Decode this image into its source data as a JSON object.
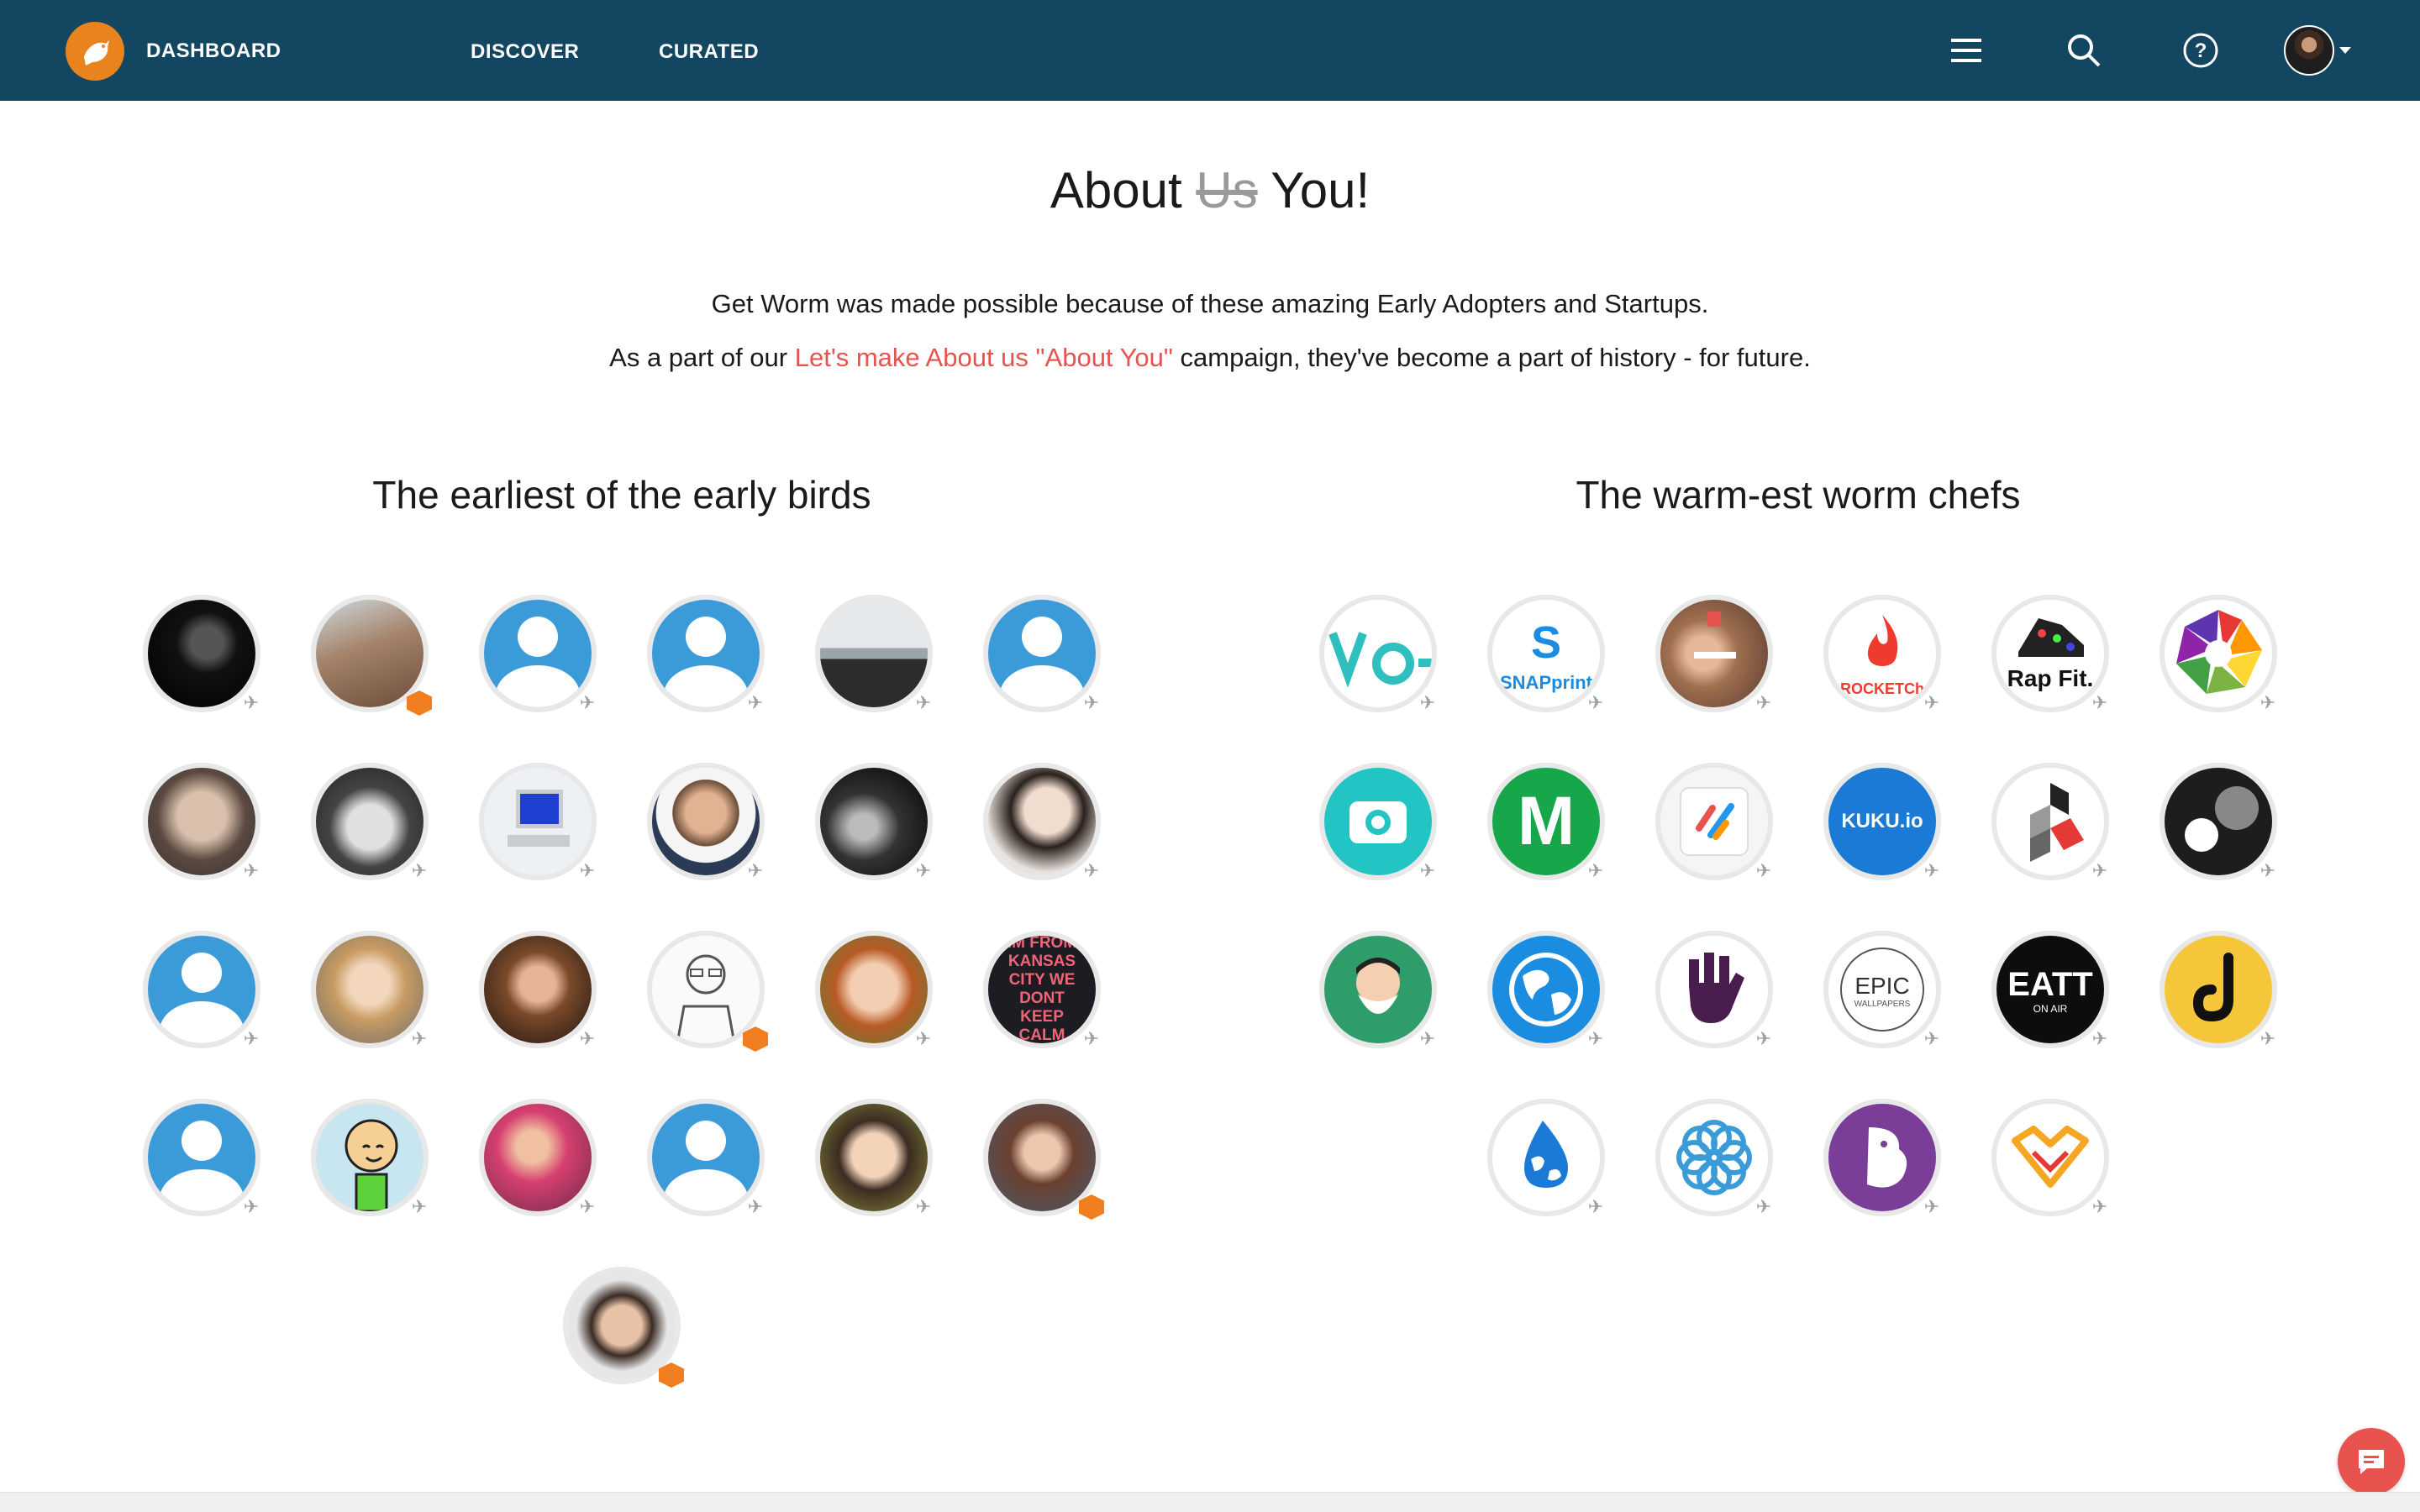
{
  "nav": {
    "brand_label": "DASHBOARD",
    "links": [
      "DISCOVER",
      "CURATED"
    ],
    "icons": [
      "menu-icon",
      "search-icon",
      "help-icon",
      "user-avatar"
    ]
  },
  "title": {
    "before": "About",
    "struck": "Us",
    "after": "You!"
  },
  "intro": {
    "line1": "Get Worm was made possible because of these amazing Early Adopters and Startups.",
    "line2_prefix": "As a part of our ",
    "line2_link": "Let's make About us \"About You\"",
    "line2_suffix": " campaign, they've become a part of history - for future."
  },
  "sections": {
    "early_birds": "The earliest of the early birds",
    "worm_chefs": "The warm-est worm chefs"
  },
  "logo_labels": {
    "snap_top": "S",
    "snap_bottom": "SNAPprint",
    "rocket": "ROCKETCh",
    "rapfit": "Rap Fit.",
    "kuku": "KUKU.io",
    "epic": "EPIC",
    "epic_sub": "WALLPAPERS",
    "eatt": "EATT",
    "eatt_sub": "ON AIR",
    "m": "M",
    "kansas": "IM FROM KANSAS CITY WE DONT KEEP CALM"
  },
  "colors": {
    "navbar": "#134660",
    "accent": "#e8534f",
    "brand_orange": "#e8831e",
    "default_avatar": "#3b9bd9"
  }
}
